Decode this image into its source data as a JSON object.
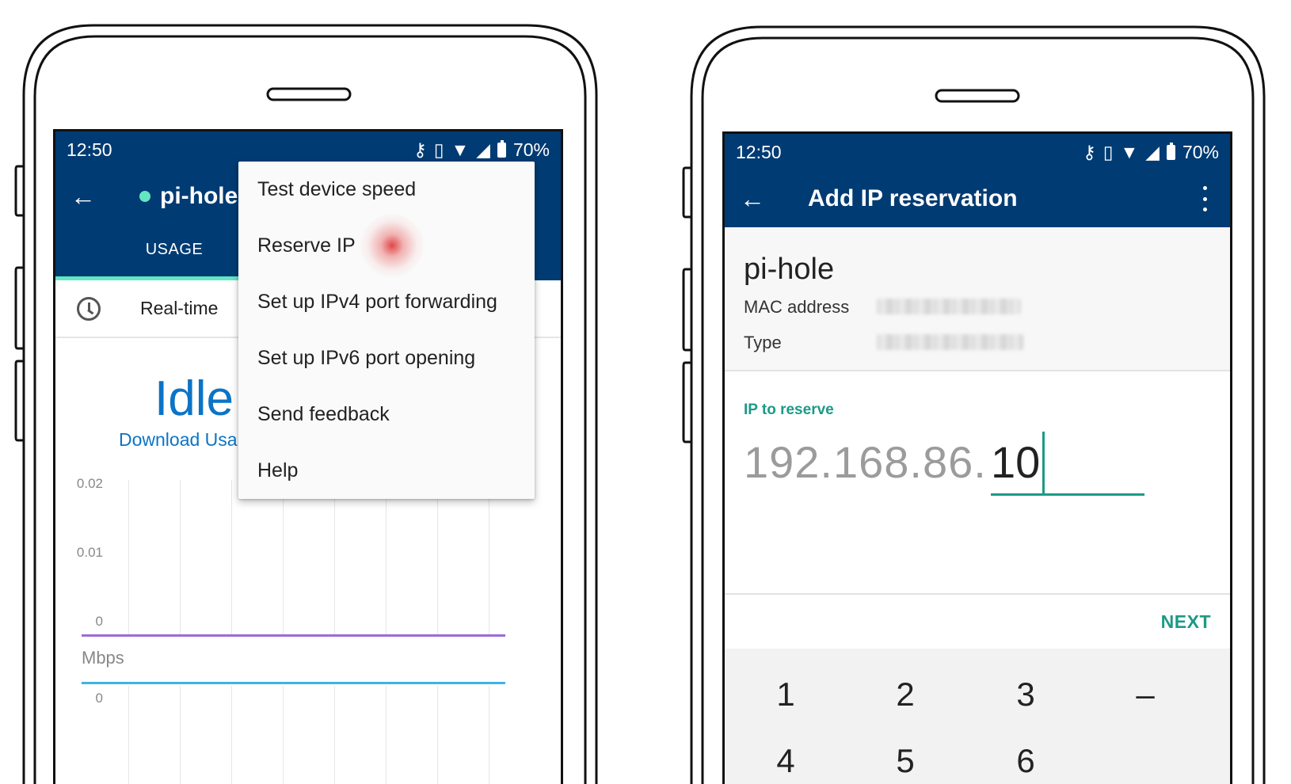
{
  "left_phone": {
    "status_bar": {
      "time": "12:50",
      "battery": "70%"
    },
    "app_bar": {
      "back_icon": "arrow-left-icon",
      "title": "pi-hole"
    },
    "tabs": [
      {
        "label": "USAGE"
      }
    ],
    "realtime": {
      "label": "Real-time",
      "icon": "clock-icon"
    },
    "state": {
      "status": "Idle",
      "sub_label": "Download Usa"
    },
    "chart_data": {
      "type": "line",
      "ylabel": "Mbps",
      "y_ticks_top": [
        "0.02",
        "0.01",
        "0"
      ],
      "y_ticks_bottom": [
        "0"
      ],
      "series_colors": [
        "#9c6bd8",
        "#3cb3e8"
      ]
    },
    "overflow_menu": {
      "items": [
        {
          "label": "Test device speed"
        },
        {
          "label": "Reserve IP"
        },
        {
          "label": "Set up IPv4 port forwarding"
        },
        {
          "label": "Set up IPv6 port opening"
        },
        {
          "label": "Send feedback"
        },
        {
          "label": "Help"
        }
      ]
    }
  },
  "right_phone": {
    "status_bar": {
      "time": "12:50",
      "battery": "70%"
    },
    "app_bar": {
      "back_icon": "arrow-left-icon",
      "title": "Add IP reservation",
      "menu_icon": "more-vert-icon"
    },
    "device": {
      "name": "pi-hole",
      "mac_label": "MAC address",
      "type_label": "Type"
    },
    "ip_field": {
      "label": "IP to reserve",
      "prefix": "192.168.86.",
      "value": "10"
    },
    "next_label": "NEXT",
    "keypad": {
      "row1": [
        "1",
        "2",
        "3",
        "–"
      ],
      "row2": [
        "4",
        "5",
        "6"
      ]
    }
  },
  "colors": {
    "app_bar": "#003b73",
    "accent_teal": "#1c9a86",
    "online_dot": "#64e6c2",
    "link_blue": "#0b74c6"
  }
}
